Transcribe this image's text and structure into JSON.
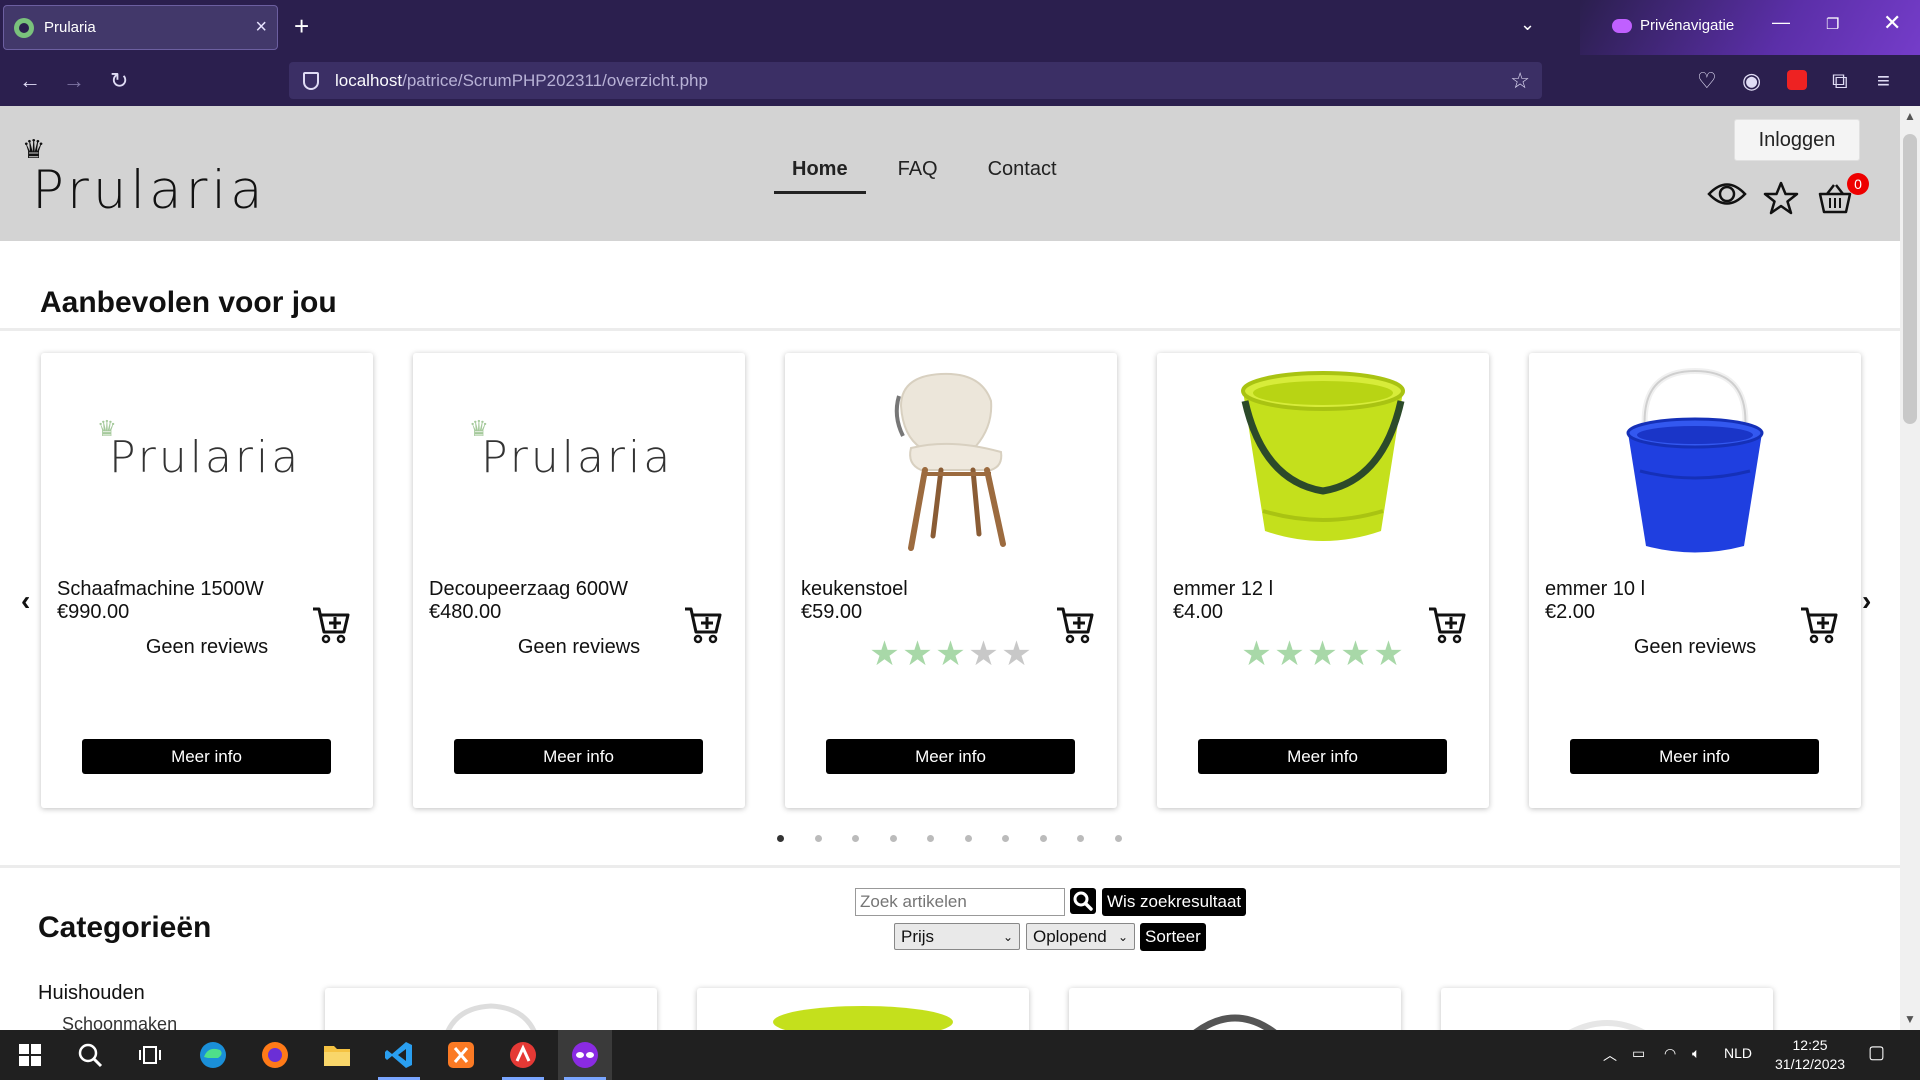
{
  "browser": {
    "tab_title": "Prularia",
    "private_label": "Privénavigatie",
    "url_host": "localhost",
    "url_path": "/patrice/ScrumPHP202311/overzicht.php"
  },
  "header": {
    "logo_text": "Prularia",
    "nav": [
      {
        "label": "Home",
        "active": true
      },
      {
        "label": "FAQ",
        "active": false
      },
      {
        "label": "Contact",
        "active": false
      }
    ],
    "login_label": "Inloggen",
    "cart_count": "0"
  },
  "recommended": {
    "title": "Aanbevolen voor jou",
    "prev_arrow": "‹",
    "next_arrow": "›",
    "products": [
      {
        "name": "Schaafmachine 1500W",
        "price": "€990.00",
        "image": "prularia-logo",
        "reviews": "Geen reviews",
        "rating": null,
        "button": "Meer info"
      },
      {
        "name": "Decoupeerzaag 600W",
        "price": "€480.00",
        "image": "prularia-logo",
        "reviews": "Geen reviews",
        "rating": null,
        "button": "Meer info"
      },
      {
        "name": "keukenstoel",
        "price": "€59.00",
        "image": "chair",
        "reviews": "",
        "rating": 3,
        "button": "Meer info"
      },
      {
        "name": "emmer 12 l",
        "price": "€4.00",
        "image": "green-bucket",
        "reviews": "",
        "rating": 5,
        "button": "Meer info"
      },
      {
        "name": "emmer 10 l",
        "price": "€2.00",
        "image": "blue-bucket",
        "reviews": "Geen reviews",
        "rating": null,
        "button": "Meer info"
      }
    ],
    "page_dots": 10,
    "active_dot": 0,
    "star_color": "#a8d8a8",
    "star_empty_color": "#c8c8c8"
  },
  "categories": {
    "title": "Categorieën",
    "items": [
      {
        "label": "Huishouden",
        "sub": [
          "Schoonmaken"
        ]
      }
    ]
  },
  "search": {
    "placeholder": "Zoek artikelen",
    "clear_label": "Wis zoekresultaat",
    "sort_field": "Prijs",
    "sort_order": "Oplopend",
    "sort_label": "Sorteer"
  },
  "taskbar": {
    "language": "NLD",
    "time": "12:25",
    "date": "31/12/2023"
  }
}
